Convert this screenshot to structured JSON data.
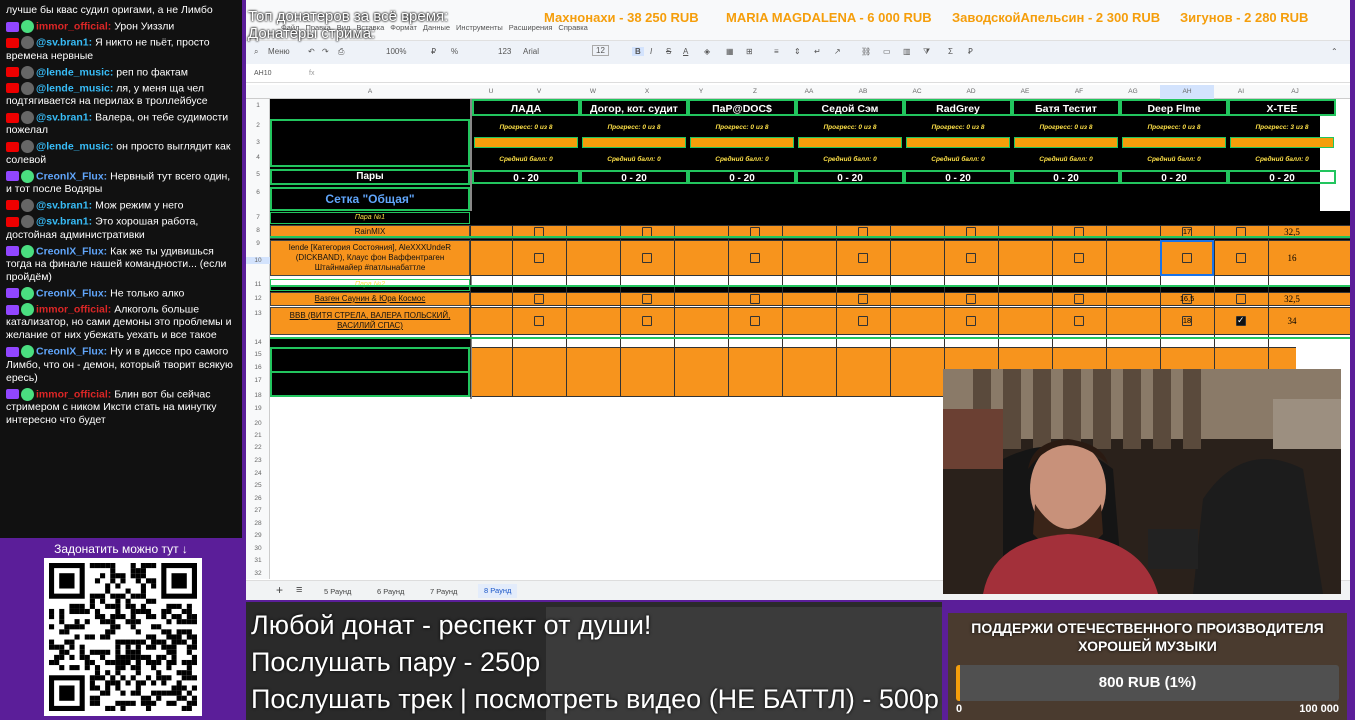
{
  "chat": {
    "messages": [
      {
        "platform": "none",
        "user": "",
        "text": "лучше бы квас судил оригами, а не Лимбо",
        "color": "#fff"
      },
      {
        "platform": "tw",
        "user": "immor_official:",
        "text": "Урон Уиззли",
        "color": "#dc2626"
      },
      {
        "platform": "yt",
        "user": "@sv.bran1:",
        "text": "Я никто не пьёт, просто времена нервные",
        "color": "#38bdf8"
      },
      {
        "platform": "yt",
        "user": "@lende_music:",
        "text": "реп по фактам",
        "color": "#38bdf8"
      },
      {
        "platform": "yt",
        "user": "@lende_music:",
        "text": "ля, у меня ща чел подтягивается на перилах в троллейбусе",
        "color": "#38bdf8"
      },
      {
        "platform": "yt",
        "user": "@sv.bran1:",
        "text": "Валера, он тебе судимости пожелал",
        "color": "#38bdf8"
      },
      {
        "platform": "yt",
        "user": "@lende_music:",
        "text": "он просто выглядит как солевой",
        "color": "#38bdf8"
      },
      {
        "platform": "tw",
        "user": "CreonIX_Flux:",
        "text": "Нервный тут всего один, и тот после Водяры",
        "color": "#60a5fa"
      },
      {
        "platform": "yt",
        "user": "@sv.bran1:",
        "text": "Мож режим у него",
        "color": "#38bdf8"
      },
      {
        "platform": "yt",
        "user": "@sv.bran1:",
        "text": "Это хорошая работа, достойная административки",
        "color": "#38bdf8"
      },
      {
        "platform": "tw",
        "user": "CreonIX_Flux:",
        "text": "Как же ты удивишься тогда на финале нашей командности... (если пройдём)",
        "color": "#60a5fa"
      },
      {
        "platform": "tw",
        "user": "CreonIX_Flux:",
        "text": "Не только алко",
        "color": "#60a5fa"
      },
      {
        "platform": "tw",
        "user": "immor_official:",
        "text": "Алкоголь больше катализатор, но сами демоны это проблемы и желание от них убежать уехать и все такое",
        "color": "#dc2626"
      },
      {
        "platform": "tw",
        "user": "CreonIX_Flux:",
        "text": "Ну и в диссе про самого Лимбо, что он - демон, который творит всякую ересь)",
        "color": "#60a5fa"
      },
      {
        "platform": "tw",
        "user": "immor_official:",
        "text": "Блин вот бы сейчас стримером с ником Иксти стать на минутку интересно что будет",
        "color": "#dc2626"
      }
    ]
  },
  "qr": {
    "title": "Задонатить можно тут ↓"
  },
  "overlay": {
    "top_title": "Топ донатеров за всё время:",
    "stream_title": "Донатеры стрима:"
  },
  "donors": [
    {
      "text": "Махнонахи - 38 250 RUB"
    },
    {
      "text": "MARIA MAGDALENA - 6 000 RUB"
    },
    {
      "text": "ЗаводскойАпельсин - 2 300 RUB"
    },
    {
      "text": "Зигунов - 2 280 RUB"
    }
  ],
  "sheet": {
    "menu": [
      "Файл",
      "Правка",
      "Вид",
      "Вставка",
      "Формат",
      "Данные",
      "Инструменты",
      "Расширения",
      "Справка"
    ],
    "toolbar": {
      "menu": "Меню",
      "zoom": "100%",
      "currency": "₽",
      "percent": "%",
      "num": "123",
      "font": "Arial",
      "size": "12"
    },
    "cell_ref": "AH10",
    "fx": "fx",
    "columns": [
      "A",
      "U",
      "V",
      "W",
      "X",
      "Y",
      "Z",
      "AA",
      "AB",
      "AC",
      "AD",
      "AE",
      "AF",
      "AG",
      "AH",
      "AI",
      "AJ"
    ],
    "rows": [
      "1",
      "2",
      "3",
      "4",
      "5",
      "6",
      "7",
      "8",
      "9",
      "10",
      "11",
      "12",
      "13",
      "14",
      "15",
      "16",
      "17",
      "18",
      "19",
      "20",
      "21",
      "22",
      "23",
      "24",
      "25",
      "26",
      "27",
      "28",
      "29",
      "30",
      "31",
      "32"
    ],
    "pairs_label": "Пары",
    "grid_label": "Сетка \"Общая\"",
    "pair1": "Пара №1",
    "pair2": "Пара №2",
    "entries": [
      {
        "name": "RainMIX"
      },
      {
        "name": "lende [Категория Состояния], AleXXXUndeR (DICKBAND), Клаус фон Ваффентраген Штайнмайер #патлынабаттле"
      },
      {
        "name": "Вазген Саунин & Юра Космос"
      },
      {
        "name": "ВВВ (ВИТЯ СТРЕЛА, ВАЛЕРА ПОЛЬСКИЙ, ВАСИЛИЙ СПАС)"
      }
    ],
    "judges": [
      {
        "name": "ЛАДА",
        "progress": "Прогресс: 0 из 8",
        "avg": "Средний балл: 0",
        "range": "0 - 20"
      },
      {
        "name": "Догор, кот. судит",
        "progress": "Прогресс: 0 из 8",
        "avg": "Средний балл: 0",
        "range": "0 - 20"
      },
      {
        "name": "ПаР@DOC$",
        "progress": "Прогресс: 0 из 8",
        "avg": "Средний балл: 0",
        "range": "0 - 20"
      },
      {
        "name": "Седой Сэм",
        "progress": "Прогресс: 0 из 8",
        "avg": "Средний балл: 0",
        "range": "0 - 20"
      },
      {
        "name": "RadGrey",
        "progress": "Прогресс: 0 из 8",
        "avg": "Средний балл: 0",
        "range": "0 - 20"
      },
      {
        "name": "Батя Тестит",
        "progress": "Прогресс: 0 из 8",
        "avg": "Средний балл: 0",
        "range": "0 - 20"
      },
      {
        "name": "Deep Flme",
        "progress": "Прогресс: 0 из 8",
        "avg": "Средний балл: 0",
        "range": "0 - 20"
      },
      {
        "name": "X-TEE",
        "progress": "Прогресс: 3 из 8",
        "avg": "Средний балл: 0",
        "range": "0 - 20"
      }
    ],
    "xtee_scores": [
      "17",
      "",
      "16,5",
      "18"
    ],
    "totals": [
      "32,5",
      "16",
      "32,5",
      "34"
    ],
    "tabs": [
      "5 Раунд",
      "6 Раунд",
      "7 Раунд",
      "8 Раунд"
    ]
  },
  "bottom": {
    "line1": "Любой донат - респект от души!",
    "line2": "Послушать пару - 250р",
    "line3": "Послушать трек | посмотреть видео (НЕ БАТТЛ) - 500р"
  },
  "support": {
    "title": "ПОДДЕРЖИ ОТЕЧЕСТВЕННОГО ПРОИЗВОДИТЕЛЯ ХОРОШЕЙ МУЗЫКИ",
    "amount": "800 RUB (1%)",
    "progress": 0.01,
    "min": "0",
    "max": "100 000"
  }
}
